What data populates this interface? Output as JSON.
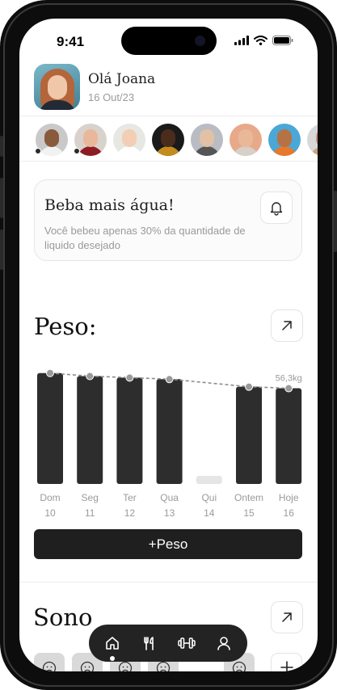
{
  "status_bar": {
    "time": "9:41"
  },
  "header": {
    "greeting": "Olá Joana",
    "date": "16 Out/23"
  },
  "stories": [
    {
      "skin": "#8a5a3c",
      "shirt": "#f2f2f2",
      "bg": "#c9c9c9",
      "online": true
    },
    {
      "skin": "#e9b89a",
      "shirt": "#8e1c25",
      "bg": "#d9d2cc",
      "online": true
    },
    {
      "skin": "#f2cfb4",
      "shirt": "#ffffff",
      "bg": "#e7e7e3",
      "online": false
    },
    {
      "skin": "#4a2c1d",
      "shirt": "#c48b1e",
      "bg": "#1a1a1a",
      "online": false
    },
    {
      "skin": "#e2c1a6",
      "shirt": "#555555",
      "bg": "#b9bcc2",
      "online": false
    },
    {
      "skin": "#e8b899",
      "shirt": "#d6d0c8",
      "bg": "#e7a98a",
      "online": false
    },
    {
      "skin": "#b57244",
      "shirt": "#e8782a",
      "bg": "#4ba7d6",
      "online": false
    },
    {
      "skin": "#c99478",
      "shirt": "#caa27f",
      "bg": "#d8d8d8",
      "online": false
    }
  ],
  "reminder": {
    "title": "Beba mais água!",
    "text": "Você bebeu apenas 30% da quantidade de liquido desejado",
    "icon": "bell-icon"
  },
  "weight": {
    "title": "Peso:",
    "button_label": "+Peso",
    "icon": "arrow-up-right-icon"
  },
  "chart_data": {
    "type": "bar",
    "categories": [
      "Dom",
      "Seg",
      "Ter",
      "Qua",
      "Qui",
      "Ontem",
      "Hoje"
    ],
    "day_numbers": [
      "10",
      "11",
      "12",
      "13",
      "14",
      "15",
      "16"
    ],
    "values": [
      57.3,
      57.1,
      57.0,
      56.9,
      null,
      56.4,
      56.3
    ],
    "last_value_label": "56,3kg",
    "ylim": [
      50,
      57.5
    ],
    "bar_color": "#2d2d2d",
    "empty_bar_color": "#e5e5e5",
    "trend_line": "dashed"
  },
  "sleep": {
    "title": "Sono",
    "icon": "arrow-up-right-icon"
  },
  "sleep_tiles": [
    {
      "icon": "sad-face-icon",
      "filled": true
    },
    {
      "icon": "sad-face-icon",
      "filled": true
    },
    {
      "icon": "sad-face-icon",
      "filled": true
    },
    {
      "icon": "sad-face-icon",
      "filled": true
    },
    {
      "icon": "",
      "filled": false
    },
    {
      "icon": "sad-face-icon",
      "filled": true
    }
  ],
  "nav": [
    {
      "name": "home",
      "icon": "home-icon",
      "active": true
    },
    {
      "name": "meals",
      "icon": "fork-knife-icon",
      "active": false
    },
    {
      "name": "workout",
      "icon": "dumbbell-icon",
      "active": false
    },
    {
      "name": "profile",
      "icon": "user-icon",
      "active": false
    }
  ]
}
